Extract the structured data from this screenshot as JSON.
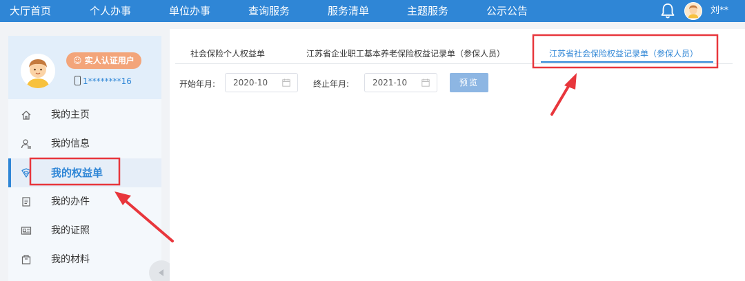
{
  "nav": {
    "items": [
      "大厅首页",
      "个人办事",
      "单位办事",
      "查询服务",
      "服务清单",
      "主题服务",
      "公示公告"
    ],
    "username": "刘**"
  },
  "profile": {
    "badge": "实人认证用户",
    "phone": "1********16"
  },
  "sidebar": {
    "items": [
      {
        "label": "我的主页",
        "icon": "home-icon"
      },
      {
        "label": "我的信息",
        "icon": "user-icon"
      },
      {
        "label": "我的权益单",
        "icon": "shield-heart-icon"
      },
      {
        "label": "我的办件",
        "icon": "document-icon"
      },
      {
        "label": "我的证照",
        "icon": "id-card-icon"
      },
      {
        "label": "我的材料",
        "icon": "folder-icon"
      }
    ],
    "active_index": 2
  },
  "tabs": [
    {
      "label": "社会保险个人权益单"
    },
    {
      "label": "江苏省企业职工基本养老保险权益记录单（参保人员）"
    },
    {
      "label": "江苏省社会保险权益记录单（参保人员）"
    }
  ],
  "active_tab": 2,
  "filters": {
    "start_label": "开始年月:",
    "start_value": "2020-10",
    "end_label": "终止年月:",
    "end_value": "2021-10",
    "preview_label": "预览"
  },
  "colors": {
    "nav_bg": "#2f86d6",
    "accent": "#2f86d6",
    "badge": "#f3a57a",
    "annotation": "#e8363c"
  }
}
